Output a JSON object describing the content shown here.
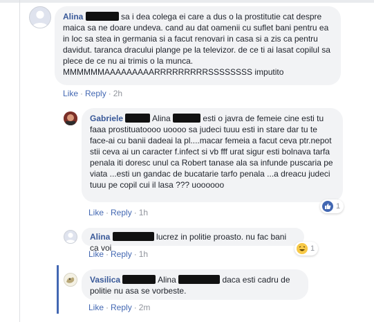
{
  "comments": [
    {
      "author": "Alina",
      "mention": "",
      "text": "sa i dea colega ei care a dus o la prostitutie cat despre maica sa ne doare undeva. cand au dat oamenii cu suflet bani pentru ea in loc sa stea in germania si a facut renovari in casa si a zis ca pentru davidut. taranca dracului plange pe la televizor. de ce ti ai lasat copilul sa plece de ce nu ai trimis o la munca. MMMMMMAAAAAAAAARRRRRRRRRSSSSSSSS imputito",
      "actions": {
        "like": "Like",
        "reply": "Reply",
        "time": "2h"
      },
      "reaction": null
    },
    {
      "author": "Gabriele",
      "mention": "Alina",
      "text": "esti o javra de femeie cine esti tu faaa prostituatoooo uoooo sa judeci tuuu esti in stare dar tu te face-ai cu banii dadeai la pl....macar femeia a facut ceva ptr.nepot stii ceva ai un caracter f.infect si vb fff urat sigur esti bolnava tarfa penala iti doresc unul ca Robert tanase ala sa infunde puscaria pe viata ...esti un gandac de bucatarie tarfo penala ...a dreacu judeci tuuu pe copil cui il lasa ??? uoooooo",
      "actions": {
        "like": "Like",
        "reply": "Reply",
        "time": "1h"
      },
      "reaction": {
        "type": "like",
        "count": "1"
      }
    },
    {
      "author": "Alina",
      "mention": "",
      "text": "lucrez in politie proasto. nu fac bani ca voi",
      "actions": {
        "like": "Like",
        "reply": "Reply",
        "time": "1h"
      },
      "reaction": {
        "type": "haha",
        "count": "1"
      }
    },
    {
      "author": "Vasilica",
      "mention": "Alina",
      "text": "daca esti cadru de politie nu asa se vorbeste.",
      "actions": {
        "like": "Like",
        "reply": "Reply",
        "time": "2m"
      },
      "reaction": null
    }
  ],
  "dot": "·",
  "colors": {
    "link": "#385898",
    "bubble": "#f2f3f5",
    "like": "#4267b2",
    "haha": "#f7c948"
  },
  "icons": [
    "default-avatar-icon",
    "thumbs-up-icon",
    "haha-icon"
  ]
}
